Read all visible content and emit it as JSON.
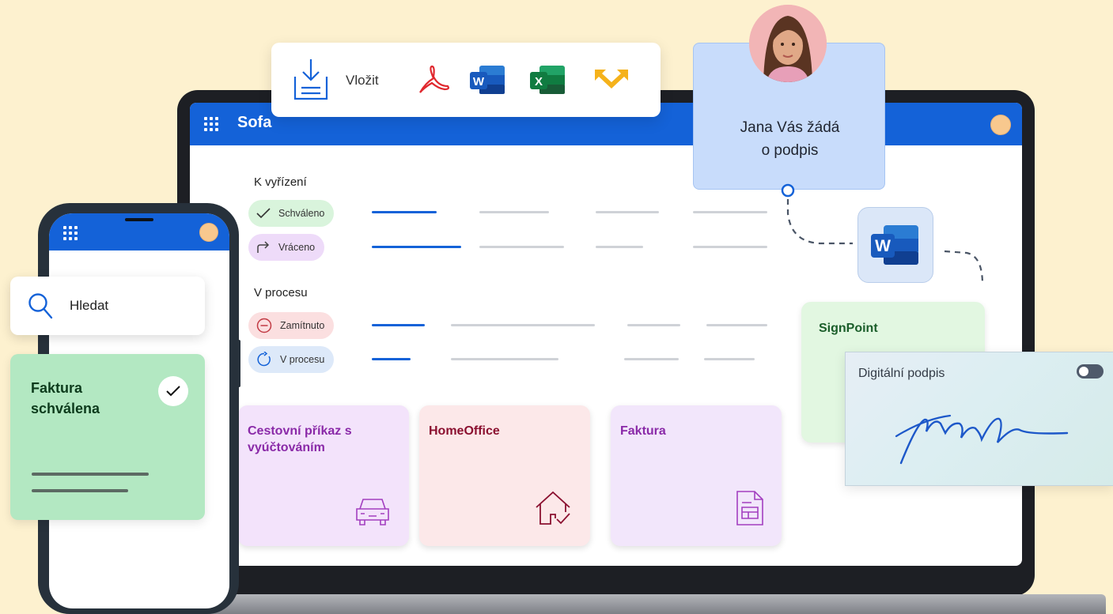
{
  "insert_toolbar": {
    "label": "Vložit",
    "icons": [
      "download-tray-icon",
      "pdf-acrobat-icon",
      "word-icon",
      "excel-icon",
      "arrows-icon"
    ]
  },
  "desktop_app": {
    "title": "Sofa",
    "sections": [
      {
        "label": "K vyřízení",
        "items": [
          {
            "label": "Schváleno",
            "icon": "check-icon",
            "color": "#d9f4dc"
          },
          {
            "label": "Vráceno",
            "icon": "return-arrow-icon",
            "color": "#eedbf9"
          }
        ]
      },
      {
        "label": "V procesu",
        "items": [
          {
            "label": "Zamítnuto",
            "icon": "minus-circle-icon",
            "color": "#fbdfe0"
          },
          {
            "label": "V procesu",
            "icon": "refresh-icon",
            "color": "#dde9f9"
          }
        ]
      }
    ],
    "cards": [
      {
        "title": "Cestovní příkaz s vyúčtováním",
        "icon": "car-icon",
        "color": "#f3e3fb",
        "text_color": "#8a2aa8"
      },
      {
        "title": "HomeOffice",
        "icon": "house-check-icon",
        "color": "#fce8e9",
        "text_color": "#8b1030"
      },
      {
        "title": "Faktura",
        "icon": "invoice-icon",
        "color": "#f2e6fb",
        "text_color": "#8a2aa8"
      }
    ]
  },
  "signature_request": {
    "text_line1": "Jana Vás žádá",
    "text_line2": "o podpis"
  },
  "signpoint": {
    "title": "SignPoint"
  },
  "digital_signature": {
    "title": "Digitální podpis",
    "toggle_on": false
  },
  "mobile_app": {
    "search_placeholder": "Hledat",
    "invoice_status_line1": "Faktura",
    "invoice_status_line2": "schválena"
  },
  "colors": {
    "accent": "#1462d8",
    "background": "#fdf1cf"
  }
}
